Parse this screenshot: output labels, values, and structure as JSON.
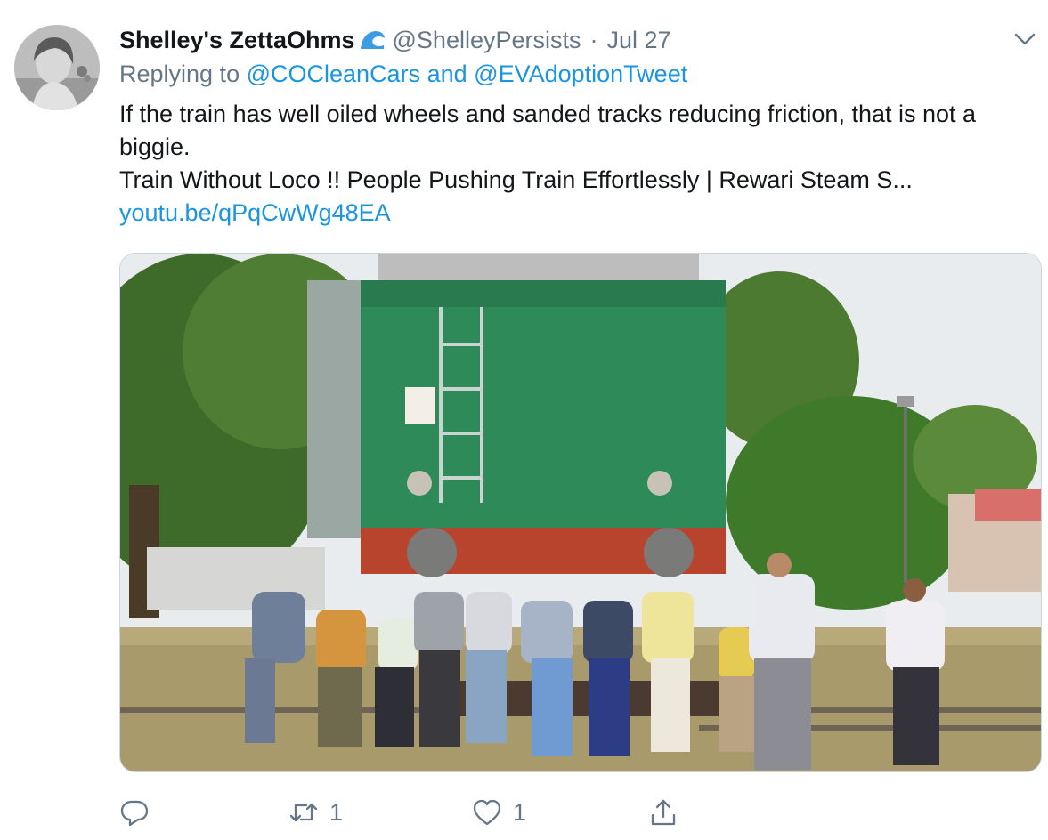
{
  "tweet": {
    "author_name": "Shelley's ZettaOhms",
    "author_emoji_icon": "water-wave-icon",
    "handle": "@ShelleyPersists",
    "separator": "·",
    "date": "Jul 27",
    "replying_label": "Replying to",
    "reply_to_1": "@COCleanCars",
    "reply_and": "and",
    "reply_to_2": "@EVAdoptionTweet",
    "text_line_1": "If the train has well oiled wheels and sanded tracks reducing friction, that is not a biggie.",
    "text_line_2": "Train Without Loco !! People Pushing Train Effortlessly | Rewari Steam S...",
    "link": "youtu.be/qPqCwWg48EA",
    "media_icon": "photo-train-pushed-by-people"
  },
  "actions": {
    "reply_icon": "comment-icon",
    "retweet_icon": "retweet-icon",
    "retweet_count": "1",
    "like_icon": "heart-icon",
    "like_count": "1",
    "share_icon": "share-icon"
  },
  "colors": {
    "link": "#1b95e0",
    "secondary_text": "#657786",
    "primary_text": "#14171a",
    "border": "#ccd6dd"
  }
}
